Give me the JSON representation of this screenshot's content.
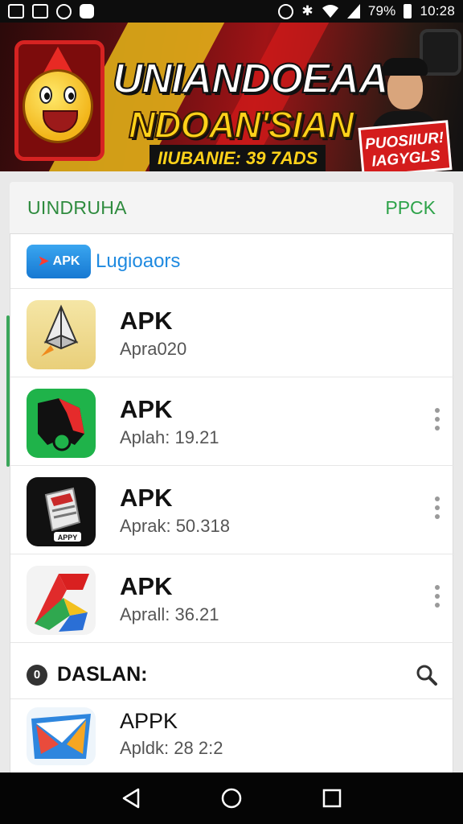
{
  "status_bar": {
    "battery": "79%",
    "time": "10:28",
    "left_icons": [
      "notification-icon",
      "image-icon",
      "sync-icon",
      "chat-icon"
    ],
    "right_icons": [
      "alarm-icon",
      "bluetooth-icon",
      "wifi-icon",
      "signal-icon",
      "battery-icon"
    ]
  },
  "banner": {
    "title_line1": "UNIANDOEAAN",
    "title_line2": "NDOAN'SIAN",
    "subtitle": "IIUBANIE: 39 7ADS",
    "badge": "PUOSIIUR! IAGYGLS"
  },
  "card_header": {
    "left_label": "UINDRUHA",
    "right_label": "PPCK"
  },
  "brand": {
    "logo_text": "APK",
    "name": "Lugioaors"
  },
  "apps": [
    {
      "title": "APK",
      "subtitle": "Apra020",
      "icon": "paper-plane-icon",
      "has_menu": false
    },
    {
      "title": "APK",
      "subtitle": "Aplah: 19.21",
      "icon": "green-map-icon",
      "has_menu": true
    },
    {
      "title": "APK",
      "subtitle": "Aprak: 50.318",
      "icon": "apk-box-icon",
      "has_menu": true
    },
    {
      "title": "APK",
      "subtitle": "Aprall: 36.21",
      "icon": "colorful-shape-icon",
      "has_menu": true
    }
  ],
  "section": {
    "badge": "0",
    "title": "DASLAN:"
  },
  "last_app": {
    "title": "APPK",
    "subtitle": "Apldk: 28 2:2",
    "icon": "blue-envelope-icon"
  },
  "colors": {
    "accent_green": "#2e8b3e",
    "banner_red": "#a01416",
    "banner_yellow": "#ffd21a",
    "brand_blue": "#1f8ae0"
  }
}
